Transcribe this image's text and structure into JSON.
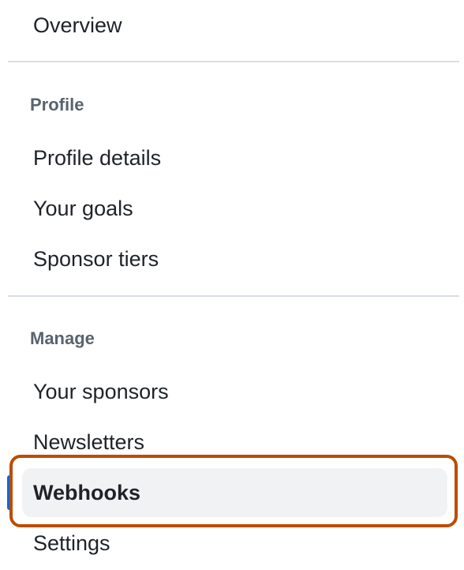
{
  "nav": {
    "overview": "Overview",
    "profile_section": {
      "heading": "Profile",
      "items": [
        "Profile details",
        "Your goals",
        "Sponsor tiers"
      ]
    },
    "manage_section": {
      "heading": "Manage",
      "items": [
        "Your sponsors",
        "Newsletters",
        "Webhooks",
        "Settings"
      ]
    },
    "active_item": "Webhooks"
  },
  "colors": {
    "highlight_border": "#bc4c00",
    "active_marker": "#0969da",
    "active_background": "#f1f2f4"
  }
}
